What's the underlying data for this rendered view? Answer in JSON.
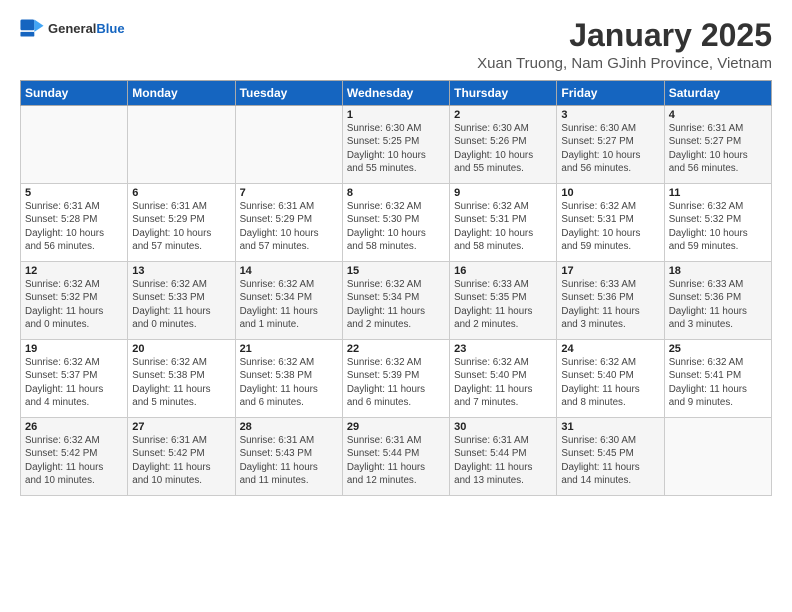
{
  "logo": {
    "general": "General",
    "blue": "Blue"
  },
  "title": "January 2025",
  "subtitle": "Xuan Truong, Nam GJinh Province, Vietnam",
  "headers": [
    "Sunday",
    "Monday",
    "Tuesday",
    "Wednesday",
    "Thursday",
    "Friday",
    "Saturday"
  ],
  "weeks": [
    [
      {
        "day": "",
        "detail": ""
      },
      {
        "day": "",
        "detail": ""
      },
      {
        "day": "",
        "detail": ""
      },
      {
        "day": "1",
        "detail": "Sunrise: 6:30 AM\nSunset: 5:25 PM\nDaylight: 10 hours\nand 55 minutes."
      },
      {
        "day": "2",
        "detail": "Sunrise: 6:30 AM\nSunset: 5:26 PM\nDaylight: 10 hours\nand 55 minutes."
      },
      {
        "day": "3",
        "detail": "Sunrise: 6:30 AM\nSunset: 5:27 PM\nDaylight: 10 hours\nand 56 minutes."
      },
      {
        "day": "4",
        "detail": "Sunrise: 6:31 AM\nSunset: 5:27 PM\nDaylight: 10 hours\nand 56 minutes."
      }
    ],
    [
      {
        "day": "5",
        "detail": "Sunrise: 6:31 AM\nSunset: 5:28 PM\nDaylight: 10 hours\nand 56 minutes."
      },
      {
        "day": "6",
        "detail": "Sunrise: 6:31 AM\nSunset: 5:29 PM\nDaylight: 10 hours\nand 57 minutes."
      },
      {
        "day": "7",
        "detail": "Sunrise: 6:31 AM\nSunset: 5:29 PM\nDaylight: 10 hours\nand 57 minutes."
      },
      {
        "day": "8",
        "detail": "Sunrise: 6:32 AM\nSunset: 5:30 PM\nDaylight: 10 hours\nand 58 minutes."
      },
      {
        "day": "9",
        "detail": "Sunrise: 6:32 AM\nSunset: 5:31 PM\nDaylight: 10 hours\nand 58 minutes."
      },
      {
        "day": "10",
        "detail": "Sunrise: 6:32 AM\nSunset: 5:31 PM\nDaylight: 10 hours\nand 59 minutes."
      },
      {
        "day": "11",
        "detail": "Sunrise: 6:32 AM\nSunset: 5:32 PM\nDaylight: 10 hours\nand 59 minutes."
      }
    ],
    [
      {
        "day": "12",
        "detail": "Sunrise: 6:32 AM\nSunset: 5:32 PM\nDaylight: 11 hours\nand 0 minutes."
      },
      {
        "day": "13",
        "detail": "Sunrise: 6:32 AM\nSunset: 5:33 PM\nDaylight: 11 hours\nand 0 minutes."
      },
      {
        "day": "14",
        "detail": "Sunrise: 6:32 AM\nSunset: 5:34 PM\nDaylight: 11 hours\nand 1 minute."
      },
      {
        "day": "15",
        "detail": "Sunrise: 6:32 AM\nSunset: 5:34 PM\nDaylight: 11 hours\nand 2 minutes."
      },
      {
        "day": "16",
        "detail": "Sunrise: 6:33 AM\nSunset: 5:35 PM\nDaylight: 11 hours\nand 2 minutes."
      },
      {
        "day": "17",
        "detail": "Sunrise: 6:33 AM\nSunset: 5:36 PM\nDaylight: 11 hours\nand 3 minutes."
      },
      {
        "day": "18",
        "detail": "Sunrise: 6:33 AM\nSunset: 5:36 PM\nDaylight: 11 hours\nand 3 minutes."
      }
    ],
    [
      {
        "day": "19",
        "detail": "Sunrise: 6:32 AM\nSunset: 5:37 PM\nDaylight: 11 hours\nand 4 minutes."
      },
      {
        "day": "20",
        "detail": "Sunrise: 6:32 AM\nSunset: 5:38 PM\nDaylight: 11 hours\nand 5 minutes."
      },
      {
        "day": "21",
        "detail": "Sunrise: 6:32 AM\nSunset: 5:38 PM\nDaylight: 11 hours\nand 6 minutes."
      },
      {
        "day": "22",
        "detail": "Sunrise: 6:32 AM\nSunset: 5:39 PM\nDaylight: 11 hours\nand 6 minutes."
      },
      {
        "day": "23",
        "detail": "Sunrise: 6:32 AM\nSunset: 5:40 PM\nDaylight: 11 hours\nand 7 minutes."
      },
      {
        "day": "24",
        "detail": "Sunrise: 6:32 AM\nSunset: 5:40 PM\nDaylight: 11 hours\nand 8 minutes."
      },
      {
        "day": "25",
        "detail": "Sunrise: 6:32 AM\nSunset: 5:41 PM\nDaylight: 11 hours\nand 9 minutes."
      }
    ],
    [
      {
        "day": "26",
        "detail": "Sunrise: 6:32 AM\nSunset: 5:42 PM\nDaylight: 11 hours\nand 10 minutes."
      },
      {
        "day": "27",
        "detail": "Sunrise: 6:31 AM\nSunset: 5:42 PM\nDaylight: 11 hours\nand 10 minutes."
      },
      {
        "day": "28",
        "detail": "Sunrise: 6:31 AM\nSunset: 5:43 PM\nDaylight: 11 hours\nand 11 minutes."
      },
      {
        "day": "29",
        "detail": "Sunrise: 6:31 AM\nSunset: 5:44 PM\nDaylight: 11 hours\nand 12 minutes."
      },
      {
        "day": "30",
        "detail": "Sunrise: 6:31 AM\nSunset: 5:44 PM\nDaylight: 11 hours\nand 13 minutes."
      },
      {
        "day": "31",
        "detail": "Sunrise: 6:30 AM\nSunset: 5:45 PM\nDaylight: 11 hours\nand 14 minutes."
      },
      {
        "day": "",
        "detail": ""
      }
    ]
  ]
}
